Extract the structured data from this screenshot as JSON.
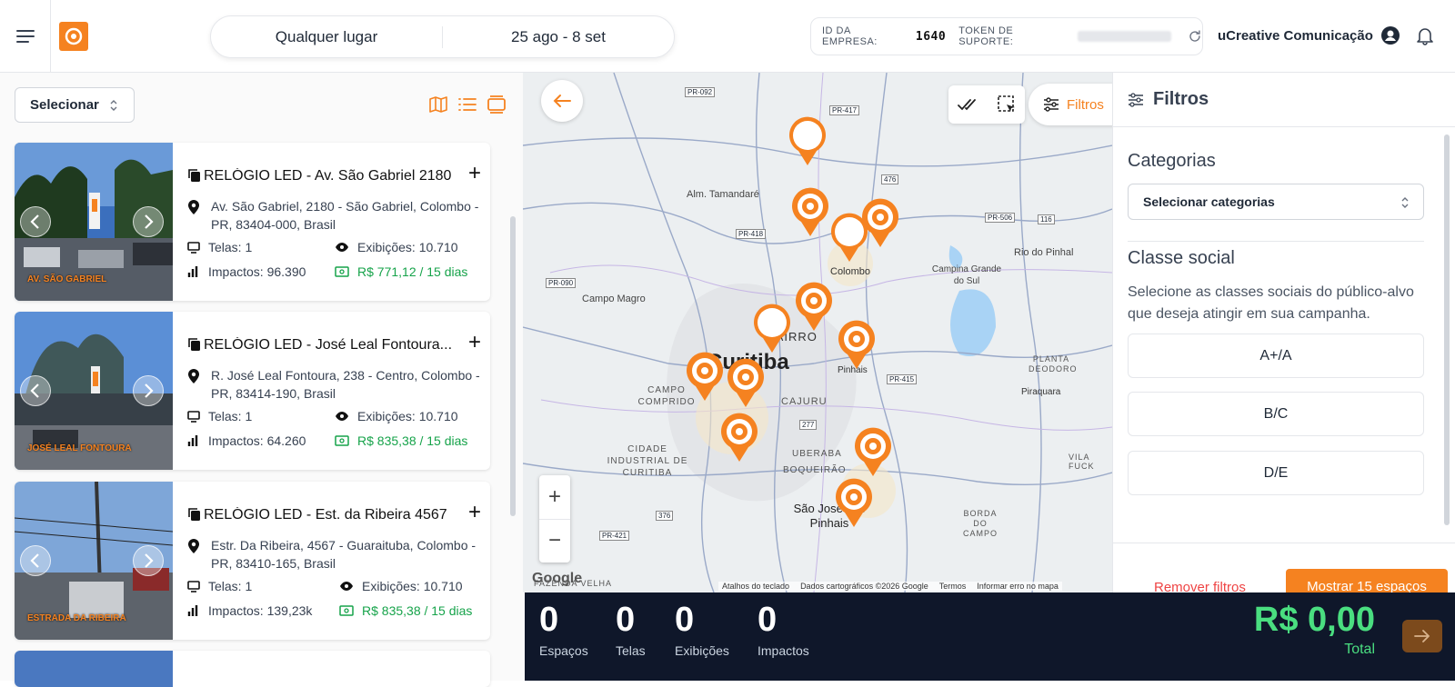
{
  "header": {
    "location": "Qualquer lugar",
    "dates": "25 ago - 8 set",
    "company_id_label": "ID DA EMPRESA:",
    "company_id": "1640",
    "support_token_label": "TOKEN DE SUPORTE:",
    "company_name": "uCreative Comunicação"
  },
  "list": {
    "select_label": "Selecionar",
    "cards": [
      {
        "title": "RELÓGIO LED - Av. São Gabriel 2180",
        "address": "Av. São Gabriel, 2180 - São Gabriel, Colombo - PR, 83404-000, Brasil",
        "screens": "Telas: 1",
        "exhibitions": "Exibições: 10.710",
        "impacts": "Impactos: 96.390",
        "price": "R$ 771,12 / 15 dias",
        "photo_text": "AV. SÃO GABRIEL"
      },
      {
        "title": "RELÓGIO LED - José Leal Fontoura...",
        "address": "R. José Leal Fontoura, 238 - Centro, Colombo - PR, 83414-190, Brasil",
        "screens": "Telas: 1",
        "exhibitions": "Exibições: 10.710",
        "impacts": "Impactos: 64.260",
        "price": "R$ 835,38 / 15 dias",
        "photo_text": "JOSÉ LEAL FONTOURA"
      },
      {
        "title": "RELÓGIO LED - Est. da Ribeira 4567",
        "address": "Estr. Da Ribeira, 4567 - Guaraituba, Colombo - PR, 83410-165, Brasil",
        "screens": "Telas: 1",
        "exhibitions": "Exibições: 10.710",
        "impacts": "Impactos: 139,23k",
        "price": "R$ 835,38 / 15 dias",
        "photo_text": "ESTRADA DA RIBEIRA"
      }
    ]
  },
  "map": {
    "filters_button": "Filtros",
    "labels": [
      "Alm. Tamandaré",
      "Colombo",
      "Campina Grande do Sul",
      "Rio do Pinhal",
      "Campo Magro",
      "Curitiba",
      "CAMPO COMPRIDO",
      "CAJURU",
      "Pinhais",
      "Piraquara",
      "CIDADE INDUSTRIAL DE CURITIBA",
      "UBERABA",
      "BOQUEIRÃO",
      "São José dos Pinhais",
      "VILA FUCK",
      "BORDA DO CAMPO",
      "PLANTA DEODORO",
      "FAZENDA VELHA",
      "BAIRRO"
    ],
    "roads": [
      "PR-092",
      "PR-417",
      "PR-418",
      "476",
      "PR-506",
      "116",
      "PR-090",
      "PR-415",
      "277",
      "376",
      "PR-421"
    ],
    "attribution": [
      "Atalhos do teclado",
      "Dados cartográficos ©2026 Google",
      "Termos",
      "Informar erro no mapa"
    ],
    "google": "Google",
    "zoom_in": "+",
    "zoom_out": "−"
  },
  "filters": {
    "title": "Filtros",
    "categories_title": "Categorias",
    "categories_select": "Selecionar categorias",
    "social_class_title": "Classe social",
    "social_class_desc": "Selecione as classes sociais do público-alvo que deseja atingir em sua campanha.",
    "classes": [
      "A+/A",
      "B/C",
      "D/E"
    ],
    "remove_label": "Remover filtros",
    "show_label": "Mostrar 15 espaços"
  },
  "summary": {
    "spaces_value": "0",
    "spaces_label": "Espaços",
    "screens_value": "0",
    "screens_label": "Telas",
    "exhibitions_value": "0",
    "exhibitions_label": "Exibições",
    "impacts_value": "0",
    "impacts_label": "Impactos",
    "total_value": "R$ 0,00",
    "total_label": "Total"
  },
  "colors": {
    "brand": "#f58220",
    "price": "#16a34a",
    "summary_bg": "#0f172a",
    "total": "#4ade80"
  }
}
